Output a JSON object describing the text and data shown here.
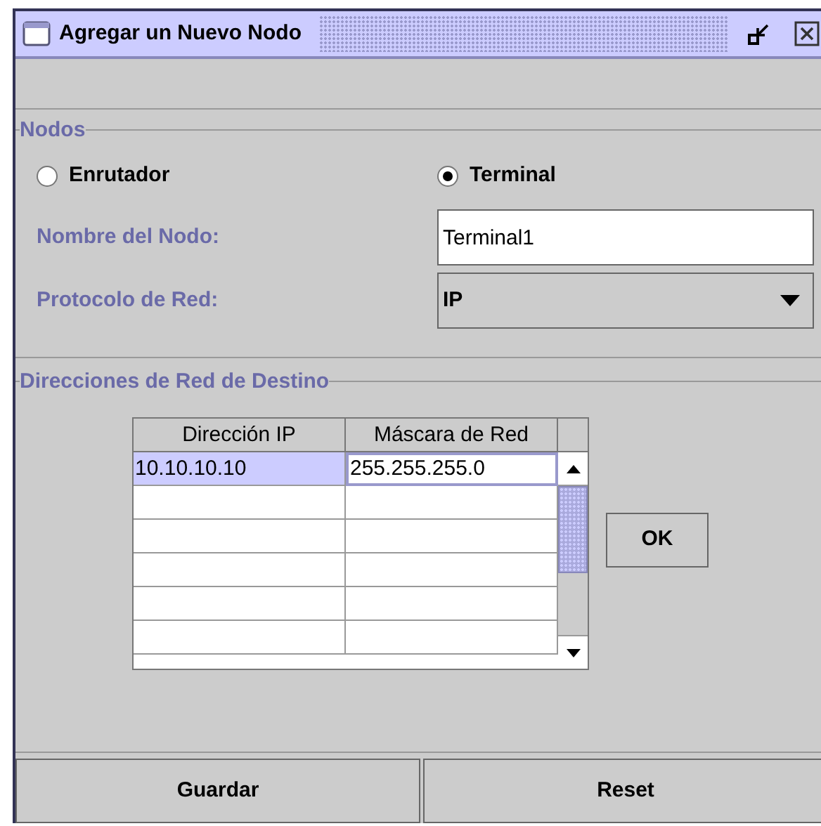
{
  "window": {
    "title": "Agregar un Nuevo Nodo"
  },
  "nodes_group": {
    "legend": "Nodos",
    "node_types": [
      {
        "label": "Enrutador",
        "selected": false
      },
      {
        "label": "Terminal",
        "selected": true
      }
    ],
    "name_label": "Nombre del Nodo:",
    "name_value": "Terminal1",
    "protocol_label": "Protocolo de Red:",
    "protocol_value": "IP"
  },
  "destinations_group": {
    "legend": "Direcciones de Red de Destino",
    "table": {
      "columns": [
        "Dirección IP",
        "Máscara de Red"
      ],
      "rows": [
        {
          "cells": [
            "10.10.10.10",
            "255.255.255.0"
          ],
          "selected": true
        }
      ]
    },
    "ok_button": "OK"
  },
  "buttons": [
    "Guardar",
    "Reset"
  ]
}
